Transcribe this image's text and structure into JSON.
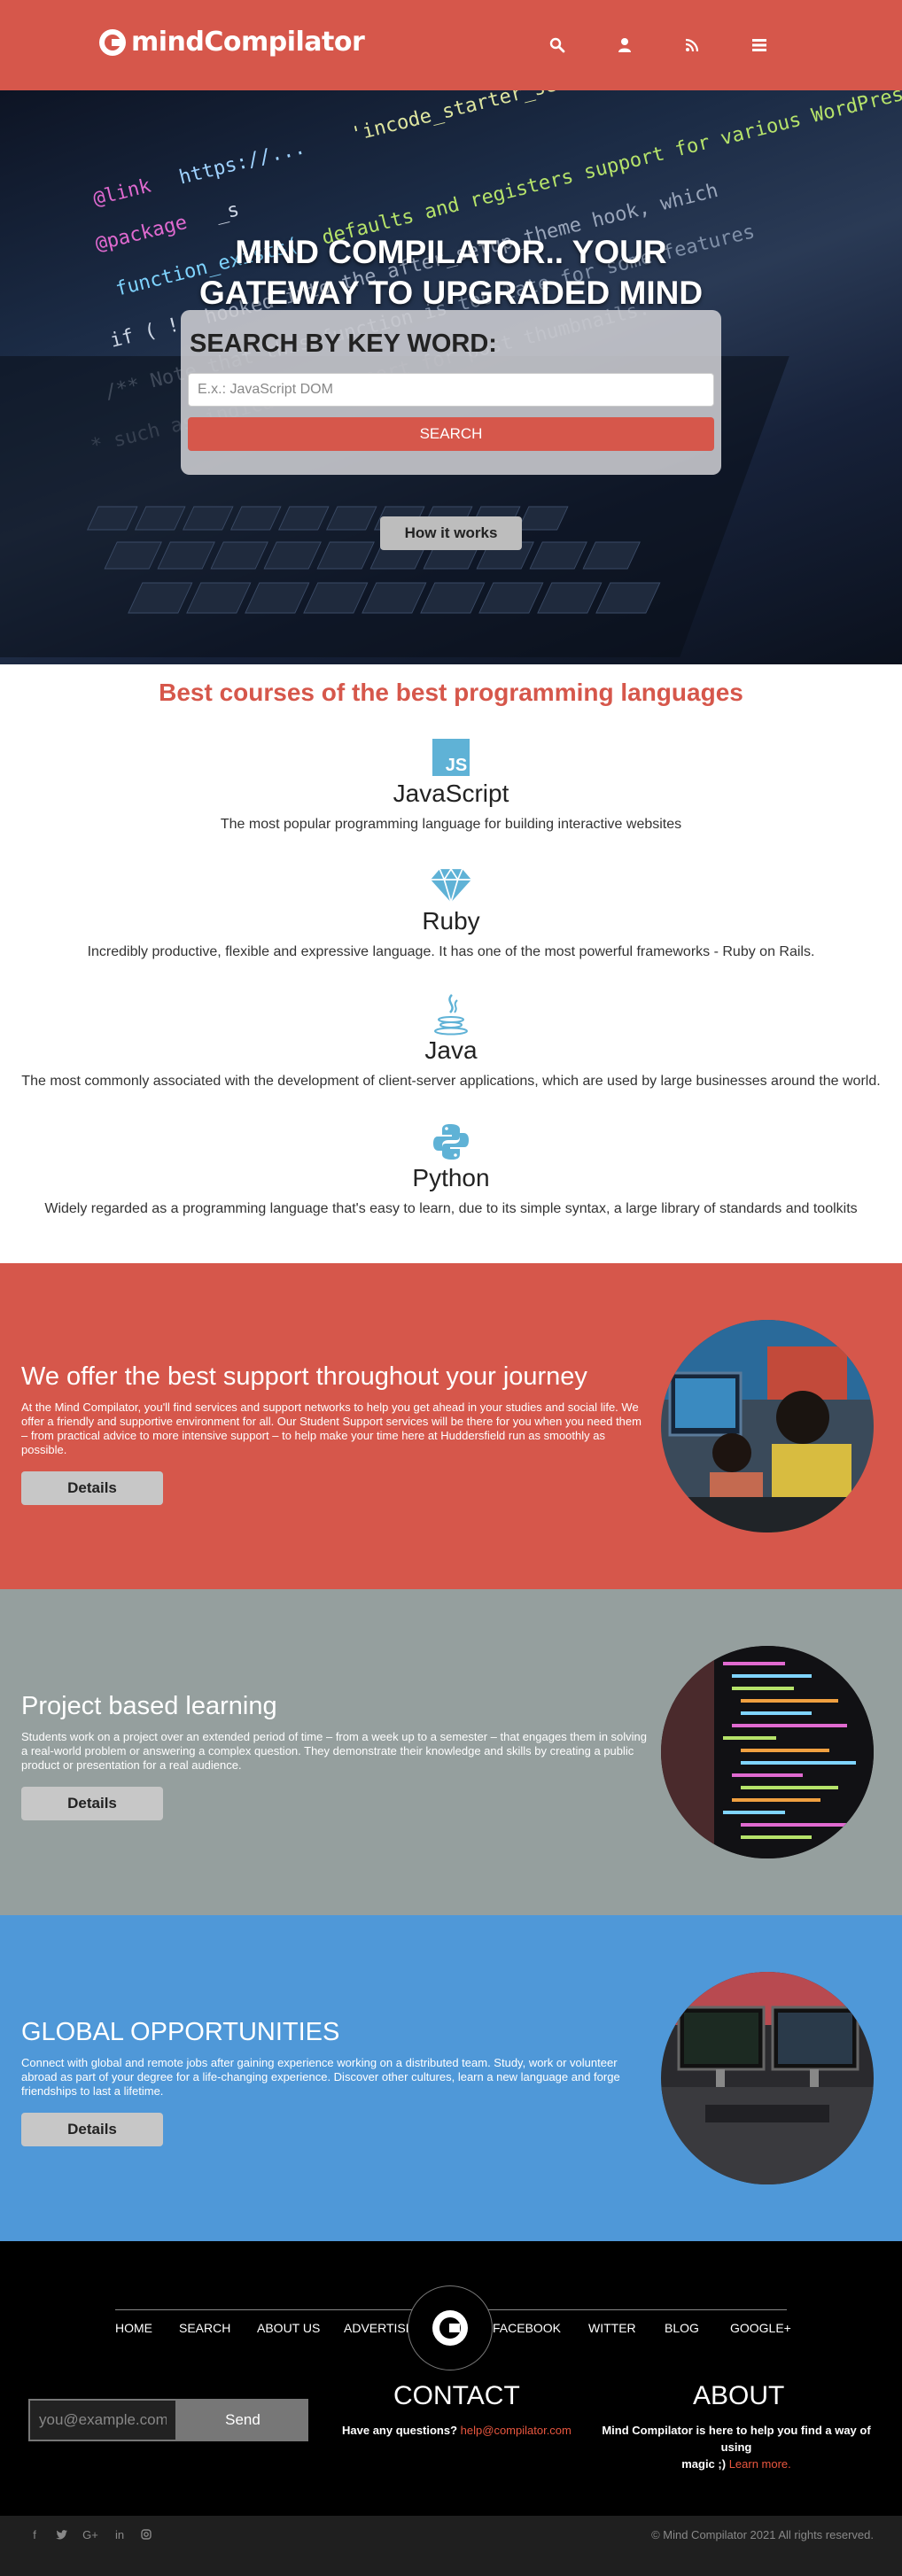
{
  "header": {
    "brand": "mindCompilator",
    "color": "#d6574b",
    "icons": [
      "search-icon",
      "user-icon",
      "rss-icon",
      "menu-icon"
    ]
  },
  "hero": {
    "title_line1": "MIND COMPILATOR.. YOUR",
    "title_line2": "GATEWAY TO UPGRADED MIND",
    "search_label": "SEARCH BY KEY WORD:",
    "search_placeholder": "E.x.: JavaScript DOM",
    "search_button": "SEARCH",
    "how_button": "How it works"
  },
  "courses": {
    "title": "Best courses of the best programming languages",
    "items": [
      {
        "name": "JavaScript",
        "icon": "js-icon",
        "desc": "The most popular programming language for building interactive websites"
      },
      {
        "name": "Ruby",
        "icon": "gem-icon",
        "desc": "Incredibly productive, flexible and expressive language. It has one of the most powerful frameworks - Ruby on Rails."
      },
      {
        "name": "Java",
        "icon": "java-icon",
        "desc": "The most commonly associated with the development of client-server applications, which are used by large businesses around the world."
      },
      {
        "name": "Python",
        "icon": "python-icon",
        "desc": "Widely regarded as a programming language that's easy to learn, due to its simple syntax, a large library of standards and toolkits"
      }
    ]
  },
  "features": [
    {
      "title": "We offer the best support throughout your journey",
      "body": "At the Mind Compilator, you'll find services and support networks to help you get ahead in your studies and social life. We offer a friendly and supportive environment for all. Our Student Support services will be there for you when you need them – from practical advice to more intensive support – to help make your time here at Huddersfield run as smoothly as possible.",
      "button": "Details",
      "bg": "#d6574b"
    },
    {
      "title": "Project based learning",
      "body": "Students work on a project over an extended period of time – from a week up to a semester – that engages them in solving a real-world problem or answering a complex question. They demonstrate their knowledge and skills by creating a public product or presentation for a real audience.",
      "button": "Details",
      "bg": "#959f9e"
    },
    {
      "title": "GLOBAL OPPORTUNITIES",
      "body": "Connect with global and remote jobs after gaining experience working on a distributed team. Study, work or volunteer abroad as part of your degree for a life-changing experience. Discover other cultures, learn a new language and forge friendships to last a lifetime.",
      "button": "Details",
      "bg": "#4f98d8"
    }
  ],
  "footer": {
    "nav": [
      "HOME",
      "SEARCH",
      "ABOUT US",
      "ADVERTISE",
      "FACEBOOK",
      "WITTER",
      "BLOG",
      "GOOGLE+"
    ],
    "email_placeholder": "you@example.com",
    "send": "Send",
    "contact_title": "CONTACT",
    "contact_text": "Have any questions?",
    "contact_email": "help@compilator.com",
    "about_title": "ABOUT",
    "about_text_1": "Mind Compilator is here to help you find a way of using",
    "about_text_2": "magic ;)",
    "about_link": "Learn more.",
    "social": [
      "facebook-icon",
      "twitter-icon",
      "google-plus-icon",
      "linkedin-icon",
      "instagram-icon"
    ],
    "copyright": "© Mind Compilator 2021 All rights reserved."
  }
}
